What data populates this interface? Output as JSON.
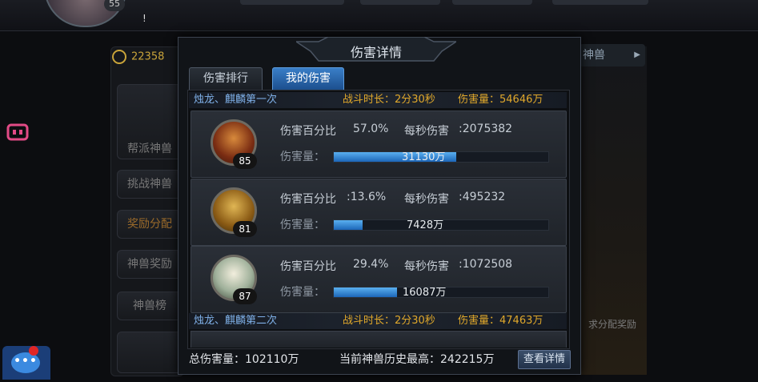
{
  "background": {
    "hero_level": "55",
    "exclamation": "!",
    "gold_amount": "22358",
    "side_menu": [
      "帮派神兽",
      "挑战神兽",
      "奖励分配",
      "神兽奖励",
      "神兽榜"
    ],
    "right_tab_label": "神兽",
    "right_note": "求分配奖励"
  },
  "dialog": {
    "title": "伤害详情",
    "tabs": [
      {
        "label": "伤害排行",
        "active": false
      },
      {
        "label": "我的伤害",
        "active": true
      }
    ],
    "battles": [
      {
        "name": "烛龙、麒麟第一次",
        "time_label": "战斗时长：2分30秒",
        "damage_label": "伤害量：54646万",
        "players": [
          {
            "level": "85",
            "percent_label": "伤害百分比",
            "percent": "57.0%",
            "dps_label": "每秒伤害",
            "dps": ":2075382",
            "dmg_label": "伤害量：",
            "damage": "31130万",
            "fill": 0.57
          },
          {
            "level": "81",
            "percent_label": "伤害百分比",
            "percent": ":13.6%",
            "dps_label": "每秒伤害",
            "dps": ":495232",
            "dmg_label": "伤害量：",
            "damage": "7428万",
            "fill": 0.136
          },
          {
            "level": "87",
            "percent_label": "伤害百分比",
            "percent": "29.4%",
            "dps_label": "每秒伤害",
            "dps": ":1072508",
            "dmg_label": "伤害量：",
            "damage": "16087万",
            "fill": 0.294
          }
        ]
      },
      {
        "name": "烛龙、麒麟第二次",
        "time_label": "战斗时长：2分30秒",
        "damage_label": "伤害量：47463万"
      }
    ],
    "footer": {
      "total_label": "总伤害量：102110万",
      "record_label": "当前神兽历史最高：242215万",
      "detail_button": "查看详情"
    }
  }
}
